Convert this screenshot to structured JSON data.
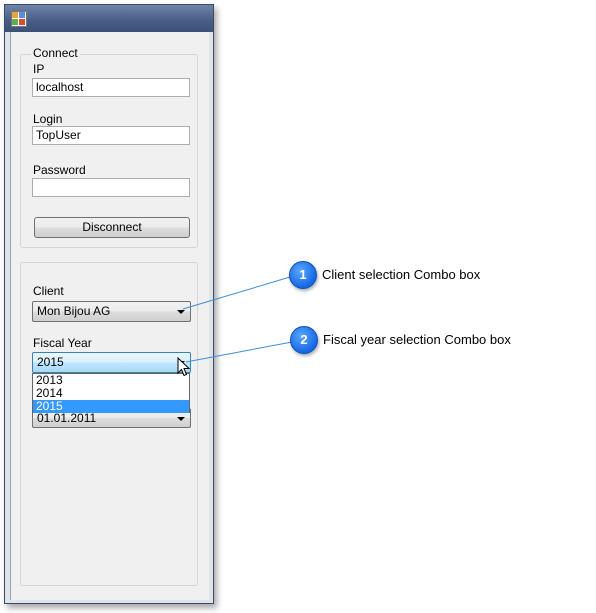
{
  "window": {
    "connect_group": {
      "legend": "Connect",
      "ip": {
        "label": "IP",
        "value": "localhost"
      },
      "login": {
        "label": "Login",
        "value": "TopUser"
      },
      "password": {
        "label": "Password",
        "value": ""
      },
      "disconnect_label": "Disconnect"
    },
    "client_group": {
      "client": {
        "label": "Client",
        "selected": "Mon Bijou AG"
      },
      "fiscal_year": {
        "label": "Fiscal Year",
        "selected": "2015",
        "options": [
          "2013",
          "2014",
          "2015"
        ]
      },
      "date_combo": {
        "selected": "01.01.2011"
      }
    }
  },
  "callouts": [
    {
      "number": "1",
      "text": "Client selection Combo box"
    },
    {
      "number": "2",
      "text": "Fiscal year selection Combo box"
    }
  ],
  "colors": {
    "badge": "#1668e3",
    "callout_line": "#3a8fd8",
    "selection": "#3399ff"
  }
}
